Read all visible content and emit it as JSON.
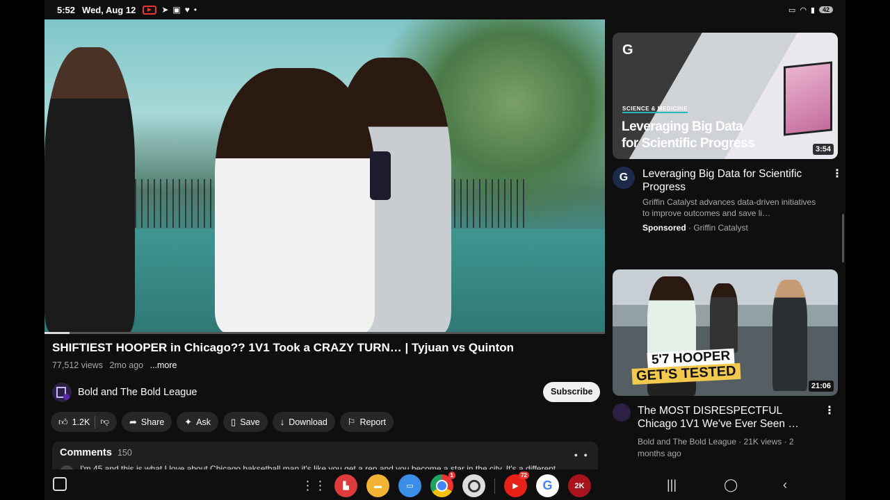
{
  "status_bar": {
    "time": "5:52",
    "date": "Wed, Aug 12",
    "battery": "42"
  },
  "player": {
    "progress_fraction": 0.045
  },
  "video": {
    "title": "SHIFTIEST HOOPER in Chicago?? 1V1 Took a CRAZY TURN… | Tyjuan vs Quinton",
    "views": "77,512 views",
    "age": "2mo ago",
    "more_label": "...more",
    "channel_name": "Bold  and The Bold League",
    "subscribe_label": "Subscribe"
  },
  "actions": {
    "like_count": "1.2K",
    "share_label": "Share",
    "ask_label": "Ask",
    "save_label": "Save",
    "download_label": "Download",
    "report_label": "Report"
  },
  "comments": {
    "title": "Comments",
    "count": "150",
    "first_comment": "I'm 45 and this is what I love about Chicago baksetball man it's like you get a rep and you become a star in the city. It's a different"
  },
  "sidebar": {
    "ad": {
      "thumb_category": "SCIENCE & MEDICINE",
      "thumb_line1": "Leveraging Big Data",
      "thumb_line2": "for Scientific Progress",
      "duration": "3:54",
      "title": "Leveraging Big Data for Scientific Progress",
      "description": "Griffin Catalyst advances data-driven initiatives to improve outcomes and save li…",
      "sponsored_label": "Sponsored",
      "advertiser": "· Griffin Catalyst"
    },
    "next_video": {
      "thumb_line1": "5'7 HOOPER",
      "thumb_line2": "GET'S TESTED",
      "duration": "21:06",
      "title": "The MOST DISRESPECTFUL Chicago 1V1 We've Ever Seen …",
      "meta": "Bold  and The Bold League · 21K views · 2 months ago"
    }
  },
  "taskbar": {
    "chrome_badge": "1",
    "youtube_badge": "72",
    "game_label": "2K"
  }
}
